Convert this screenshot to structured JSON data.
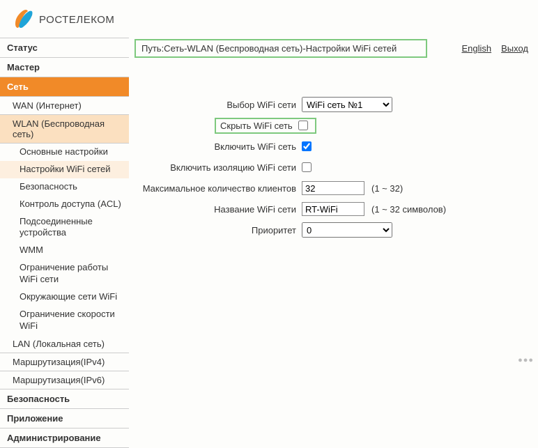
{
  "brand": "РОСТЕЛЕКОМ",
  "breadcrumb": "Путь:Сеть-WLAN (Беспроводная сеть)-Настройки WiFi сетей",
  "links": {
    "english": "English",
    "logout": "Выход"
  },
  "nav": {
    "status": "Статус",
    "wizard": "Мастер",
    "network": "Сеть",
    "wan": "WAN (Интернет)",
    "wlan": "WLAN (Беспроводная сеть)",
    "wlan_sub": {
      "basic": "Основные настройки",
      "wifi": "Настройки WiFi сетей",
      "security": "Безопасность",
      "acl": "Контроль доступа (ACL)",
      "devices": "Подсоединенные устройства",
      "wmm": "WMM",
      "restrict": "Ограничение работы WiFi сети",
      "surround": "Окружающие сети WiFi",
      "speed": "Ограничение скорости WiFi"
    },
    "lan": "LAN (Локальная сеть)",
    "ipv4": "Маршрутизация(IPv4)",
    "ipv6": "Маршрутизация(IPv6)",
    "sec": "Безопасность",
    "app": "Приложение",
    "admin": "Администрирование"
  },
  "form": {
    "select_label": "Выбор WiFi сети",
    "select_value": "WiFi сеть №1",
    "hide_label": "Скрыть WiFi сеть",
    "hide_checked": false,
    "enable_label": "Включить WiFi сеть",
    "enable_checked": true,
    "isolate_label": "Включить изоляцию WiFi сети",
    "isolate_checked": false,
    "maxclients_label": "Максимальное количество клиентов",
    "maxclients_value": "32",
    "maxclients_hint": "(1 ~ 32)",
    "ssid_label": "Название WiFi сети",
    "ssid_value": "RT-WiFi",
    "ssid_hint": "(1 ~ 32 символов)",
    "priority_label": "Приоритет",
    "priority_value": "0"
  }
}
